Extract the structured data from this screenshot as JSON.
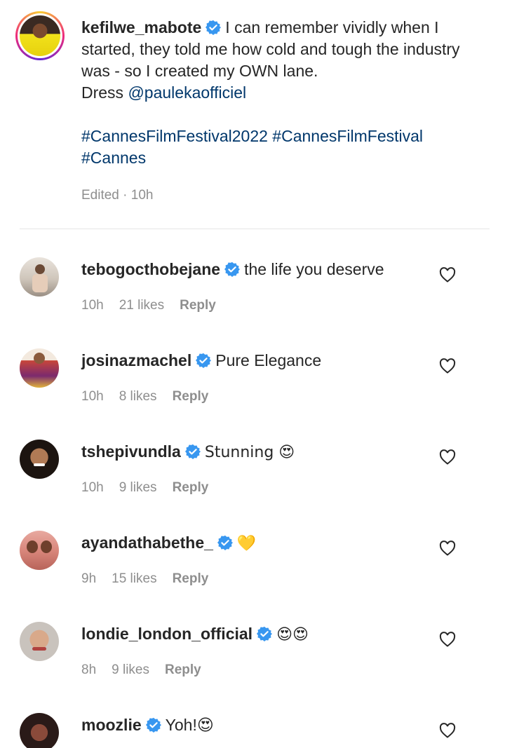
{
  "post": {
    "username": "kefilwe_mabote",
    "caption_line1": "I can remember vividly when I started, they told me how cold and tough the industry was - so I created my OWN lane.",
    "dress_prefix": "Dress",
    "dress_mention": "@paulekaofficiel",
    "hashtags": "#CannesFilmFestival2022 #CannesFilmFestival #Cannes",
    "edited": "Edited",
    "time": "10h"
  },
  "comments": [
    {
      "username": "tebogocthobejane",
      "text": "the life you deserve",
      "time": "10h",
      "likes": "21 likes",
      "reply": "Reply"
    },
    {
      "username": "josinazmachel",
      "text": "Pure Elegance",
      "time": "10h",
      "likes": "8 likes",
      "reply": "Reply"
    },
    {
      "username": "tshepivundla",
      "text": "Stunning 😍",
      "time": "10h",
      "likes": "9 likes",
      "reply": "Reply"
    },
    {
      "username": "ayandathabethe_",
      "text": "💛",
      "time": "9h",
      "likes": "15 likes",
      "reply": "Reply"
    },
    {
      "username": "londie_london_official",
      "text": "😍😍",
      "time": "8h",
      "likes": "9 likes",
      "reply": "Reply"
    },
    {
      "username": "moozlie",
      "text": "Yoh!😍",
      "time": "",
      "likes": "",
      "reply": ""
    }
  ],
  "icons": {
    "verified": "verified-badge-icon",
    "like": "heart-outline-icon"
  },
  "colors": {
    "link": "#00376b",
    "verified": "#3897f0",
    "meta": "#8e8e8e"
  }
}
